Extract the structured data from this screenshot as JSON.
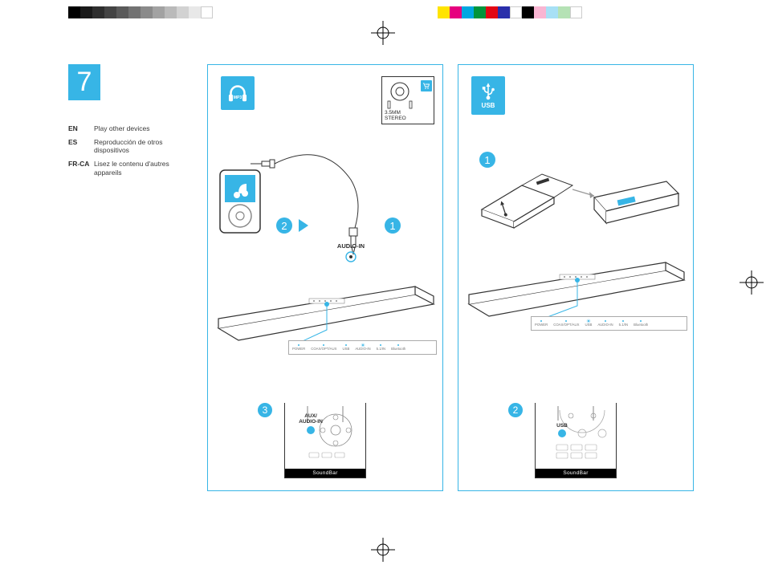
{
  "step_number": "7",
  "langs": [
    {
      "code": "EN",
      "text": "Play other devices"
    },
    {
      "code": "ES",
      "text": "Reproducción de otros dispositivos"
    },
    {
      "code": "FR-CA",
      "text": "Lisez le contenu d'autres appareils"
    }
  ],
  "panel_mp3": {
    "badge": "MP3",
    "accessory": {
      "line1": "3.5MM",
      "line2": "STEREO"
    },
    "steps": {
      "s1": "1",
      "s2": "2",
      "s3": "3"
    },
    "audio_in_label": "AUDIO-IN",
    "indicators": [
      "POWER",
      "COAX/OPT/AUX",
      "USB",
      "AUDIO-IN",
      "5.1/IN",
      "Bluetooth"
    ],
    "active_indicator": "AUDIO-IN",
    "remote_button": {
      "line1": "AUX/",
      "line2": "AUDIO-IN"
    },
    "remote_footer": "SoundBar"
  },
  "panel_usb": {
    "badge": "USB",
    "steps": {
      "s1": "1",
      "s2": "2"
    },
    "indicators": [
      "POWER",
      "COAX/OPT/AUX",
      "USB",
      "AUDIO-IN",
      "5.1/IN",
      "Bluetooth"
    ],
    "active_indicator": "USB",
    "remote_button": "USB",
    "remote_footer": "SoundBar"
  }
}
